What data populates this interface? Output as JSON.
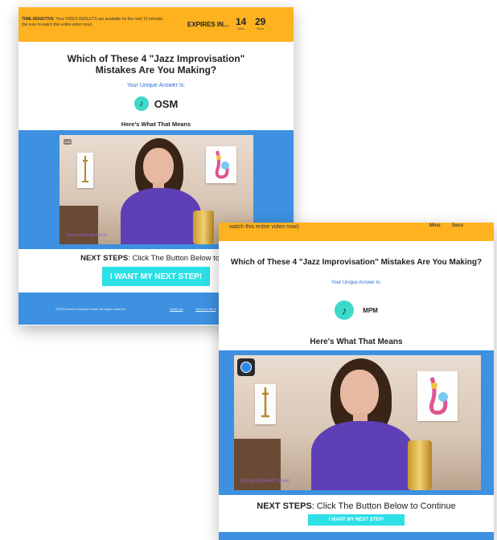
{
  "back": {
    "timer": {
      "label": "TIME-SENSITIVE",
      "text": ": Your VIDEO RESULTS are available for the next 15 minutes (be sure to watch this entire video now).",
      "expires": "EXPIRES IN...",
      "mins": "14",
      "mins_unit": "Mins",
      "secs": "29",
      "secs_unit": "Secs"
    },
    "headline": "Which of These 4 \"Jazz Improvisation\" Mistakes Are You Making?",
    "subline": "Your Unique Answer Is:",
    "code": "OSM",
    "means": "Here's What That Means",
    "video_badge": "1:00",
    "watermark": "Donna Schwartz Music",
    "next_label": "NEXT STEPS",
    "next_text": ": Click The Button Below to Co",
    "cta": "I WANT MY NEXT STEP!",
    "footer": {
      "copyright": "©2025 Donna Schwartz Music All rights reserved.",
      "about": "About Us",
      "terms": "Terms of Servi"
    }
  },
  "front": {
    "timer": {
      "text": "watch this entire video now).",
      "mins_unit": "Mins",
      "secs_unit": "Secs"
    },
    "headline": "Which of These 4 \"Jazz Improvisation\" Mistakes Are You Making?",
    "subline": "Your Unique Answer Is:",
    "code": "MPM",
    "means": "Here's What That Means",
    "watermark": "Donna Schwartz Music",
    "next_label": "NEXT STEPS",
    "next_text": ": Click The Button Below to Continue",
    "cta": "I WANT MY NEXT STEP!"
  },
  "icons": {
    "note": "music-note-icon",
    "play": "play-icon"
  },
  "colors": {
    "timer": "#ffb21f",
    "band": "#3d91e0",
    "cta": "#2ce0e6",
    "accent": "#3ed9c8",
    "link": "#2a6fcf"
  }
}
